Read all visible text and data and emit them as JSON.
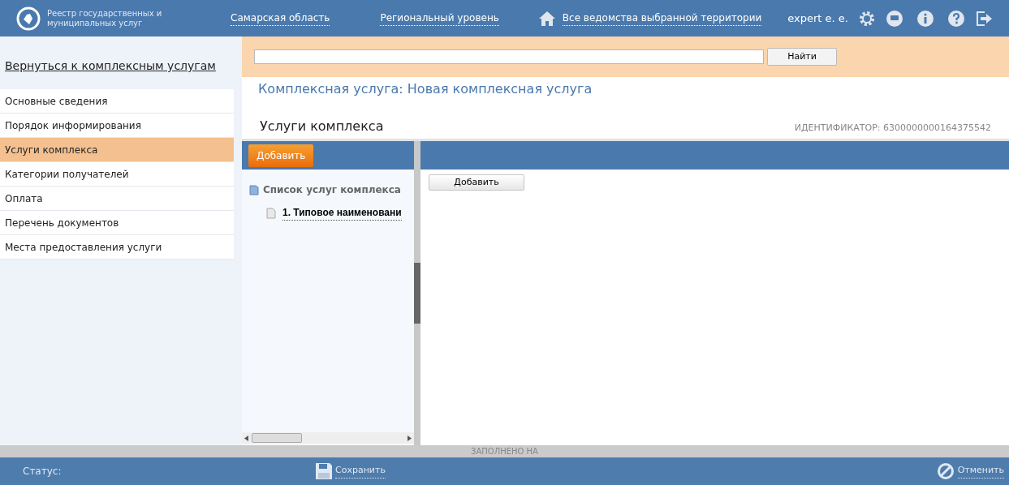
{
  "header": {
    "app_name": "Реестр государственных и муниципальных услуг",
    "region": "Самарская область",
    "level": "Региональный уровень",
    "departments": "Все ведомства выбранной территории",
    "user": "expert e. e."
  },
  "sidebar": {
    "back_link": "Вернуться к комплексным услугам",
    "items": [
      {
        "label": "Основные сведения",
        "selected": false
      },
      {
        "label": "Порядок информирования",
        "selected": false
      },
      {
        "label": "Услуги комплекса",
        "selected": true
      },
      {
        "label": "Категории получателей",
        "selected": false
      },
      {
        "label": "Оплата",
        "selected": false
      },
      {
        "label": "Перечень документов",
        "selected": false
      },
      {
        "label": "Места предоставления услуги",
        "selected": false
      }
    ]
  },
  "search": {
    "button": "Найти"
  },
  "page_title": "Комплексная услуга: Новая комплексная услуга",
  "section": {
    "title": "Услуги комплекса",
    "identifier": "ИДЕНТИФИКАТОР: 6300000000164375542"
  },
  "tree_panel": {
    "add_button": "Добавить",
    "root": {
      "label": "Список услуг комплекса",
      "children": [
        {
          "label": "1. Типовое наименовани"
        }
      ]
    }
  },
  "detail_panel": {
    "add_button": "Добавить"
  },
  "filled_bar": "ЗАПОЛНЕНО НА",
  "footer": {
    "status_label": "Статус:",
    "save": "Сохранить",
    "cancel": "Отменить"
  }
}
